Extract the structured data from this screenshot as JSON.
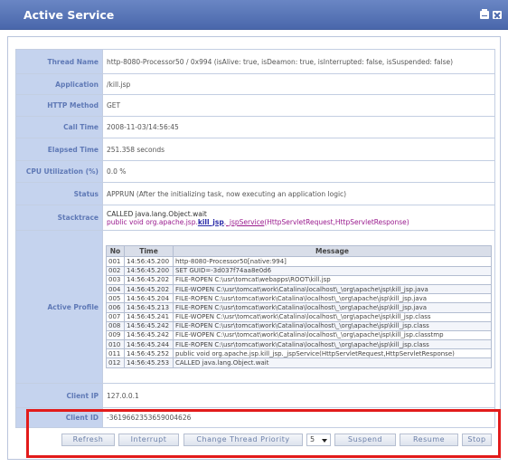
{
  "window": {
    "title": "Active Service",
    "actions": [
      {
        "icon": "print-icon"
      },
      {
        "icon": "close-icon"
      }
    ]
  },
  "fields": {
    "thread_name": {
      "label": "Thread Name",
      "value": "http-8080-Processor50 / 0x994 (isAlive: true, isDeamon: true, isInterrupted: false, isSuspended: false)"
    },
    "application": {
      "label": "Application",
      "value": "/kill.jsp"
    },
    "http_method": {
      "label": "HTTP Method",
      "value": "GET"
    },
    "call_time": {
      "label": "Call Time",
      "value": "2008-11-03/14:56:45"
    },
    "elapsed_time": {
      "label": "Elapsed Time",
      "value": "251.358 seconds"
    },
    "cpu_utilization": {
      "label": "CPU Utilization (%)",
      "value": "0.0 %"
    },
    "status": {
      "label": "Status",
      "value": "APPRUN (After the initializing task, now executing an application logic)"
    },
    "stacktrace": {
      "label": "Stacktrace",
      "line1": "CALLED java.lang.Object.wait",
      "line2_prefix": "public void org.apache.jsp.",
      "line2_kill": "kill_jsp",
      "line2_dot": ".",
      "line2_method": "_jspService",
      "line2_args": "(HttpServletRequest,HttpServletResponse)"
    },
    "active_profile": {
      "label": "Active Profile"
    },
    "client_ip": {
      "label": "Client IP",
      "value": "127.0.0.1"
    },
    "client_id": {
      "label": "Client ID",
      "value": "-3619662353659004626"
    }
  },
  "profile": {
    "columns": [
      "No",
      "Time",
      "Message"
    ],
    "rows": [
      {
        "no": "001",
        "time": "14:56:45.200",
        "message": "http-8080-Processor50[native:994]"
      },
      {
        "no": "002",
        "time": "14:56:45.200",
        "message": "SET GUID=-3d037f74aa8e0d6"
      },
      {
        "no": "003",
        "time": "14:56:45.202",
        "message": "FILE-ROPEN C:\\usr\\tomcat\\webapps\\ROOT\\kill.jsp"
      },
      {
        "no": "004",
        "time": "14:56:45.202",
        "message": "FILE-WOPEN C:\\usr\\tomcat\\work\\Catalina\\localhost\\_\\org\\apache\\jsp\\kill_jsp.java"
      },
      {
        "no": "005",
        "time": "14:56:45.204",
        "message": "FILE-ROPEN C:\\usr\\tomcat\\work\\Catalina\\localhost\\_\\org\\apache\\jsp\\kill_jsp.java"
      },
      {
        "no": "006",
        "time": "14:56:45.213",
        "message": "FILE-ROPEN C:\\usr\\tomcat\\work\\Catalina\\localhost\\_\\org\\apache\\jsp\\kill_jsp.java"
      },
      {
        "no": "007",
        "time": "14:56:45.241",
        "message": "FILE-WOPEN C:\\usr\\tomcat\\work\\Catalina\\localhost\\_\\org\\apache\\jsp\\kill_jsp.class"
      },
      {
        "no": "008",
        "time": "14:56:45.242",
        "message": "FILE-ROPEN C:\\usr\\tomcat\\work\\Catalina\\localhost\\_\\org\\apache\\jsp\\kill_jsp.class"
      },
      {
        "no": "009",
        "time": "14:56:45.242",
        "message": "FILE-WOPEN C:\\usr\\tomcat\\work\\Catalina\\localhost\\_\\org\\apache\\jsp\\kill_jsp.classtmp"
      },
      {
        "no": "010",
        "time": "14:56:45.244",
        "message": "FILE-ROPEN C:\\usr\\tomcat\\work\\Catalina\\localhost\\_\\org\\apache\\jsp\\kill_jsp.class"
      },
      {
        "no": "011",
        "time": "14:56:45.252",
        "message": "public void org.apache.jsp.kill_jsp._jspService(HttpServletRequest,HttpServletResponse)"
      },
      {
        "no": "012",
        "time": "14:56:45.253",
        "message": "CALLED java.lang.Object.wait"
      }
    ]
  },
  "toolbar": {
    "refresh": "Refresh",
    "interrupt": "Interrupt",
    "change_priority": "Change Thread Priority",
    "priority_value": "5",
    "suspend": "Suspend",
    "resume": "Resume",
    "stop": "Stop"
  },
  "colors": {
    "titlebar": "#5674b8",
    "label_bg": "#c5d3ee",
    "label_text": "#5f79b6",
    "highlight": "#e21b1b"
  }
}
